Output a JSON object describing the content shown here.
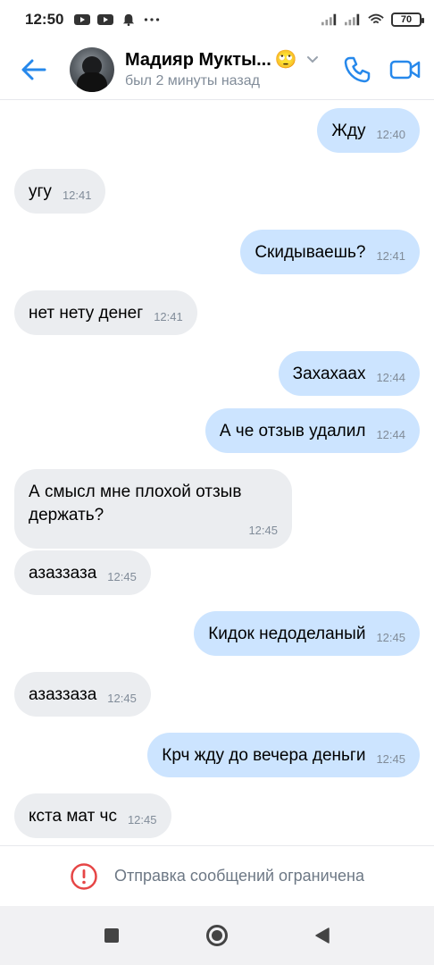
{
  "status_bar": {
    "time": "12:50",
    "icons": [
      "youtube-icon",
      "youtube-icon",
      "notification-bell-icon",
      "more-dots-icon"
    ],
    "right_icons": [
      "signal-icon",
      "signal-icon",
      "wifi-icon",
      "battery-icon"
    ],
    "battery": "70"
  },
  "header": {
    "contact_name": "Мадияр Мукты...",
    "emoji": "🙄",
    "status": "был 2 минуты назад"
  },
  "messages": [
    {
      "dir": "out",
      "text": "Жду",
      "time": "12:40"
    },
    {
      "dir": "in",
      "text": "угу",
      "time": "12:41"
    },
    {
      "dir": "out",
      "text": "Скидываешь?",
      "time": "12:41"
    },
    {
      "dir": "in",
      "text": "нет нету денег",
      "time": "12:41"
    },
    {
      "dir": "out",
      "text": "Захахаах",
      "time": "12:44"
    },
    {
      "dir": "out",
      "text": "А че отзыв удалил",
      "time": "12:44"
    },
    {
      "dir": "in",
      "text": "А смысл мне плохой отзыв\nдержать?",
      "time": "12:45"
    },
    {
      "dir": "in",
      "text": "азаззаза",
      "time": "12:45"
    },
    {
      "dir": "out",
      "text": "Кидок недоделаный",
      "time": "12:45"
    },
    {
      "dir": "in",
      "text": "азаззаза",
      "time": "12:45"
    },
    {
      "dir": "out",
      "text": "Крч жду до вечера деньги",
      "time": "12:45"
    },
    {
      "dir": "in",
      "text": "кста мат чс",
      "time": "12:45"
    }
  ],
  "restriction": {
    "text": "Отправка сообщений ограничена"
  },
  "colors": {
    "accent": "#2688eb",
    "incoming_bubble": "#ebedf0",
    "outgoing_bubble": "#cce4ff",
    "error": "#e64646",
    "secondary_text": "#818c99"
  }
}
